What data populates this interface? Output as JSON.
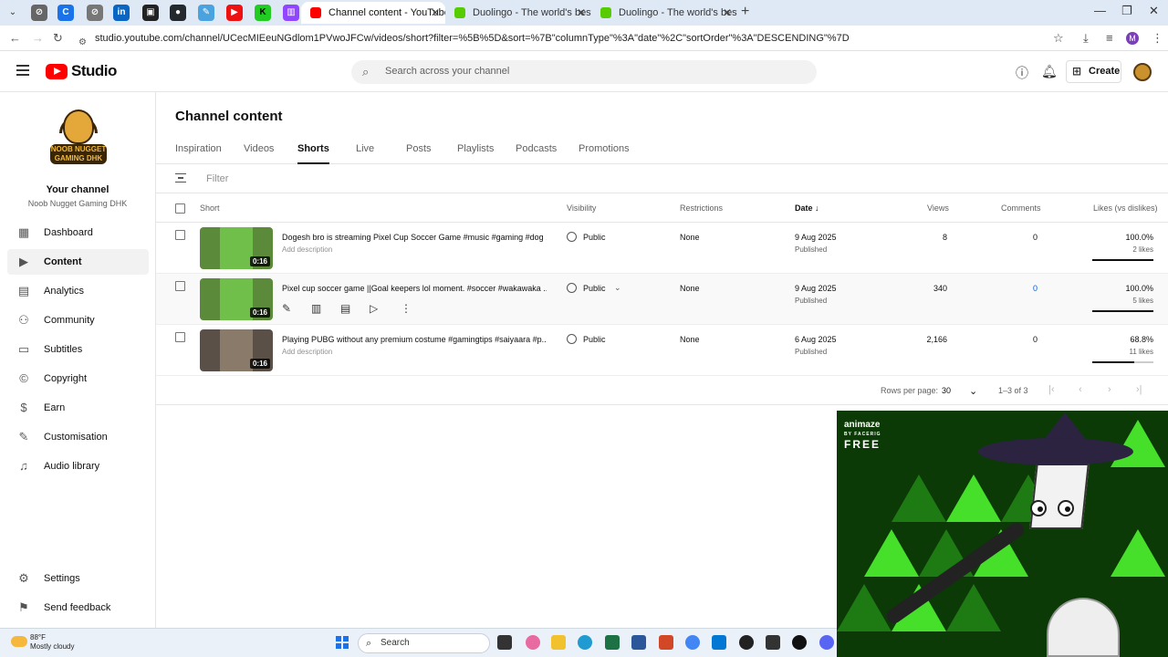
{
  "browser": {
    "tabs": [
      {
        "title": "Channel content - YouTube Stu",
        "active": true,
        "favicon_color": "#ff0000"
      },
      {
        "title": "Duolingo - The world's best wa",
        "active": false,
        "favicon_color": "#58cc02"
      },
      {
        "title": "Duolingo - The world's best wa",
        "active": false,
        "favicon_color": "#58cc02"
      }
    ],
    "url": "studio.youtube.com/channel/UCecMIEeuNGdlom1PVwoJFCw/videos/short?filter=%5B%5D&sort=%7B\"columnType\"%3A\"date\"%2C\"sortOrder\"%3A\"DESCENDING\"%7D",
    "profile_initial": "M"
  },
  "header": {
    "logo_text": "Studio",
    "search_placeholder": "Search across your channel",
    "create_label": "Create"
  },
  "sidebar": {
    "your_channel": "Your channel",
    "channel_name": "Noob Nugget Gaming DHK",
    "avatar_text": "NOOB NUGGET GAMING DHK",
    "items": [
      {
        "label": "Dashboard",
        "icon": "dashboard-icon",
        "active": false
      },
      {
        "label": "Content",
        "icon": "content-icon",
        "active": true
      },
      {
        "label": "Analytics",
        "icon": "analytics-icon",
        "active": false
      },
      {
        "label": "Community",
        "icon": "community-icon",
        "active": false
      },
      {
        "label": "Subtitles",
        "icon": "subtitles-icon",
        "active": false
      },
      {
        "label": "Copyright",
        "icon": "copyright-icon",
        "active": false
      },
      {
        "label": "Earn",
        "icon": "earn-icon",
        "active": false
      },
      {
        "label": "Customisation",
        "icon": "customisation-icon",
        "active": false
      },
      {
        "label": "Audio library",
        "icon": "audio-library-icon",
        "active": false
      }
    ],
    "bottom": [
      {
        "label": "Settings",
        "icon": "settings-icon"
      },
      {
        "label": "Send feedback",
        "icon": "feedback-icon"
      }
    ]
  },
  "main": {
    "title": "Channel content",
    "tabs": [
      "Inspiration",
      "Videos",
      "Shorts",
      "Live",
      "Posts",
      "Playlists",
      "Podcasts",
      "Promotions"
    ],
    "active_tab": "Shorts",
    "filter_placeholder": "Filter",
    "columns": {
      "short": "Short",
      "visibility": "Visibility",
      "restrictions": "Restrictions",
      "date": "Date",
      "views": "Views",
      "comments": "Comments",
      "likes": "Likes (vs dislikes)"
    },
    "rows": [
      {
        "title": "Dogesh bro is streaming Pixel Cup Soccer Game #music #gaming #dog ...",
        "description": "Add description",
        "duration": "0:16",
        "visibility": "Public",
        "restrictions": "None",
        "date": "9 Aug 2025",
        "status": "Published",
        "views": "8",
        "comments": "0",
        "likes_pct": "100.0%",
        "likes_count": "2 likes",
        "like_ratio": 1.0
      },
      {
        "title": "Pixel cup soccer game ||Goal keepers lol moment. #soccer #wakawaka ...",
        "description": "",
        "duration": "0:16",
        "visibility": "Public",
        "restrictions": "None",
        "date": "9 Aug 2025",
        "status": "Published",
        "views": "340",
        "comments": "0",
        "likes_pct": "100.0%",
        "likes_count": "5 likes",
        "like_ratio": 1.0
      },
      {
        "title": "Playing PUBG without any premium costume #gamingtips #saiyaara #p...",
        "description": "Add description",
        "duration": "0:16",
        "visibility": "Public",
        "restrictions": "None",
        "date": "6 Aug 2025",
        "status": "Published",
        "views": "2,166",
        "comments": "0",
        "likes_pct": "68.8%",
        "likes_count": "11 likes",
        "like_ratio": 0.688
      }
    ],
    "pager": {
      "rows_per_page_label": "Rows per page:",
      "rows_per_page": "30",
      "range": "1–3 of 3"
    }
  },
  "overlay": {
    "brand": "animaze",
    "by": "BY FACERIG",
    "tier": "FREE"
  },
  "taskbar": {
    "temp": "88°F",
    "weather": "Mostly cloudy",
    "search_label": "Search"
  }
}
